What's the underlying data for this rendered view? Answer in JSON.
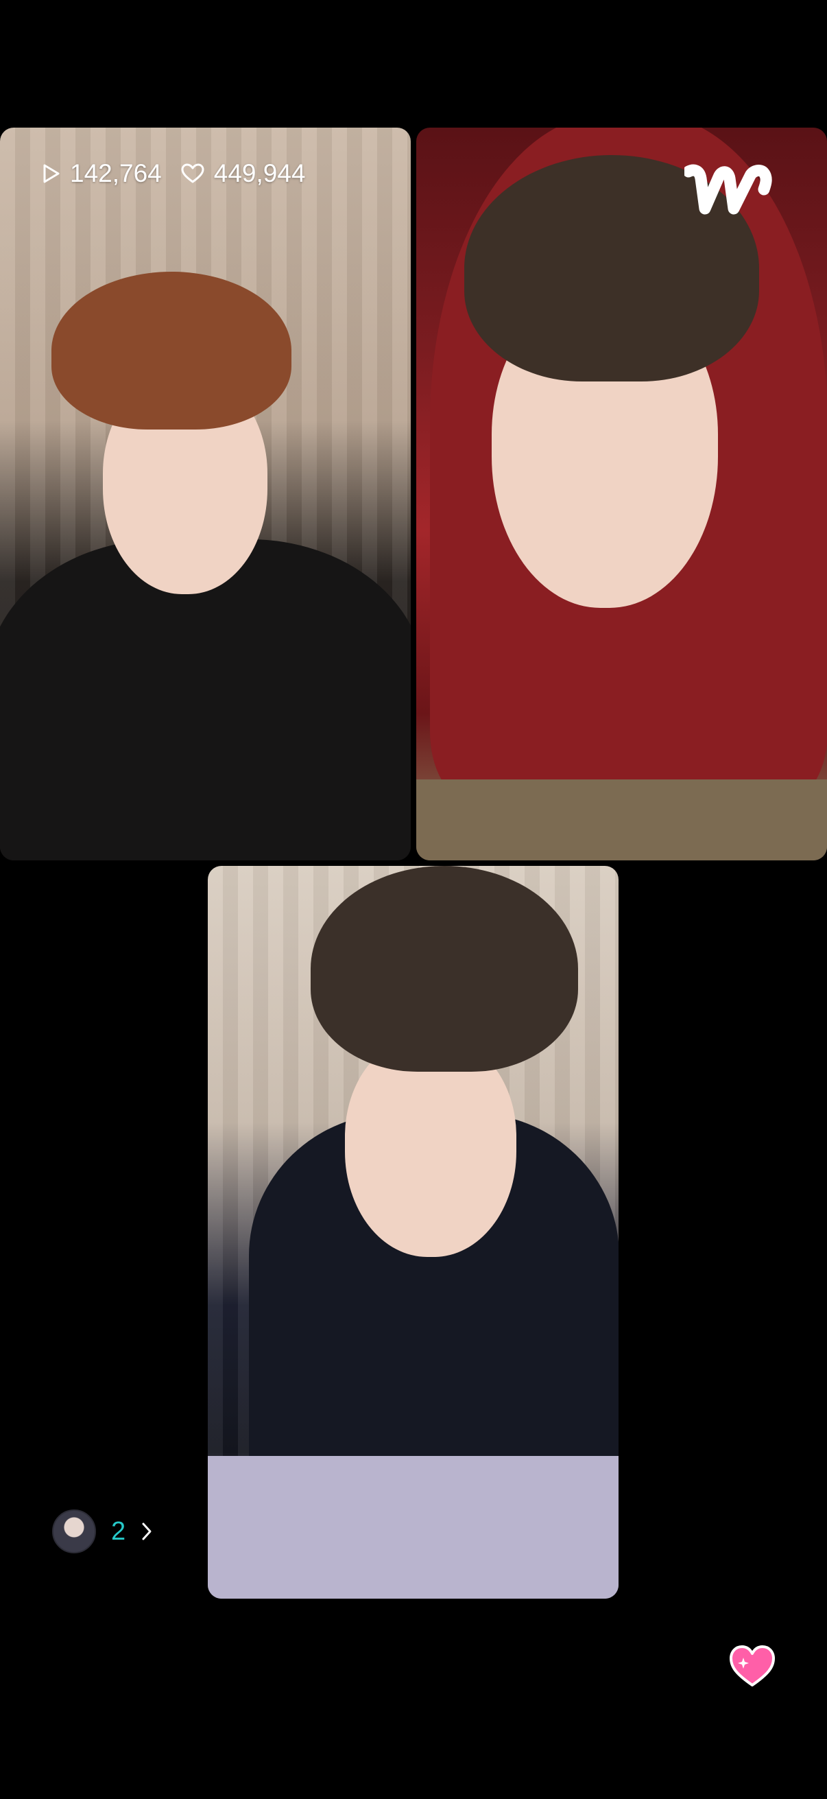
{
  "stats": {
    "plays": "142,764",
    "likes": "449,944"
  },
  "viewers": {
    "count": "2"
  },
  "icons": {
    "play": "play-outline-icon",
    "likes": "heart-outline-icon",
    "logo": "weverse-logo",
    "chevron": "chevron-right-icon",
    "reaction": "heart-sparkle-icon"
  },
  "colors": {
    "background": "#000000",
    "viewer_count": "#26c9c9",
    "reaction_heart": "#ff5fa8"
  }
}
